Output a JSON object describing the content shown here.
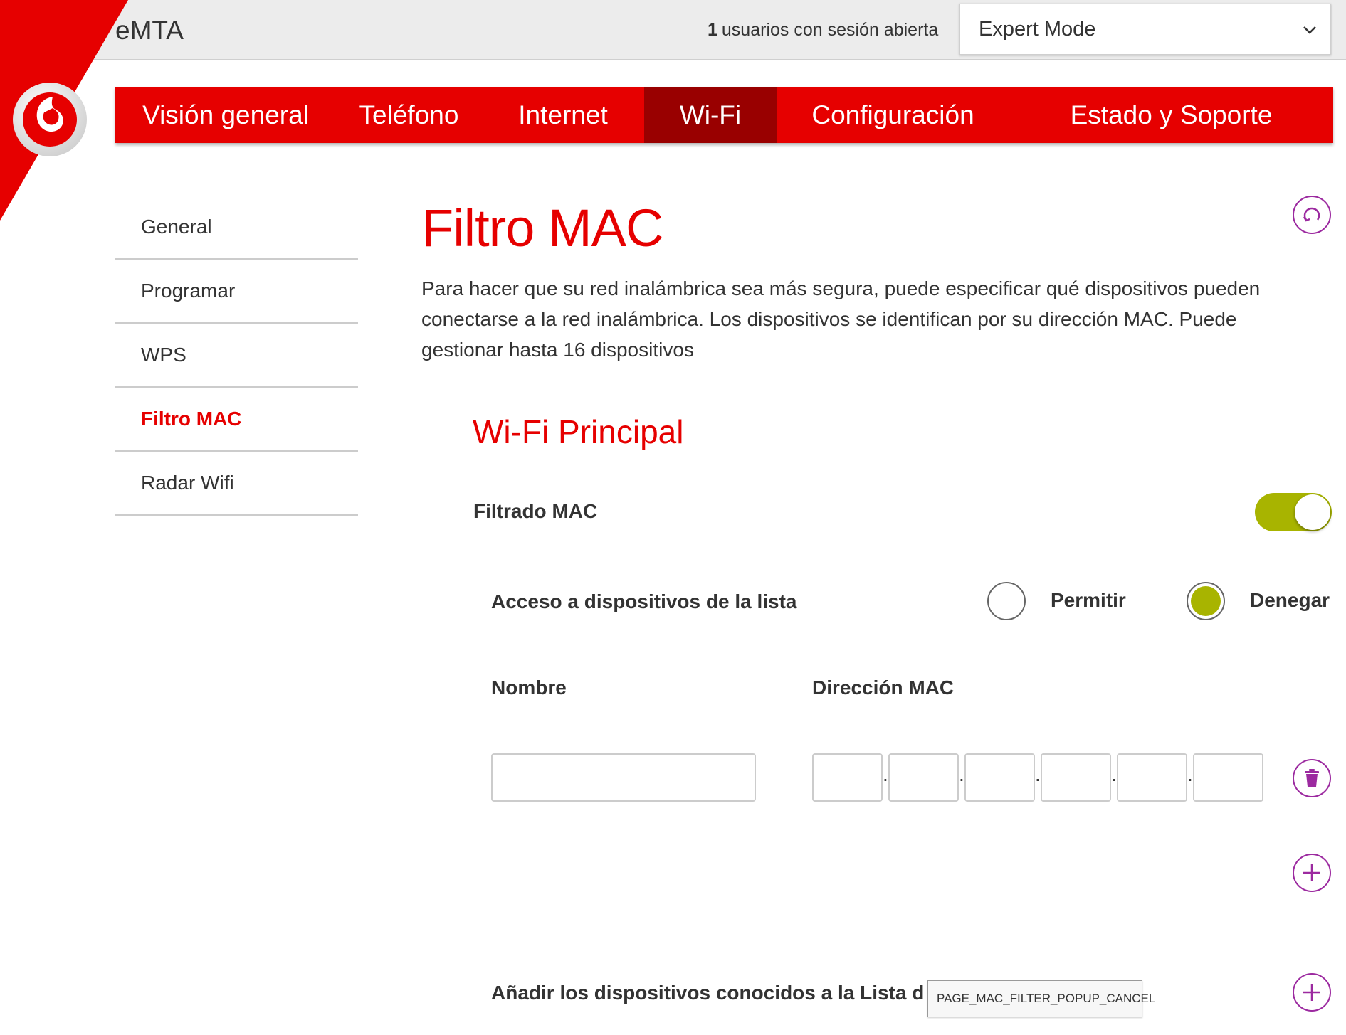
{
  "header": {
    "app_title": "eMTA",
    "users_count": "1",
    "users_text": "usuarios con sesión abierta",
    "mode_selected": "Expert Mode"
  },
  "nav": {
    "items": [
      "Visión general",
      "Teléfono",
      "Internet",
      "Wi-Fi",
      "Configuración",
      "Estado y Soporte"
    ],
    "active": "Wi-Fi"
  },
  "sidebar": {
    "items": [
      "General",
      "Programar",
      "WPS",
      "Filtro MAC",
      "Radar Wifi"
    ],
    "active": "Filtro MAC"
  },
  "main": {
    "title": "Filtro MAC",
    "description": "Para hacer que su red inalámbrica sea más segura, puede especificar qué dispositivos pueden conectarse a la red inalámbrica. Los dispositivos se identifican por su dirección MAC. Puede gestionar hasta 16 dispositivos",
    "section_title": "Wi-Fi Principal",
    "mac_filter_label": "Filtrado MAC",
    "mac_filter_enabled": true,
    "access_label": "Acceso a dispositivos de la lista",
    "access_options": [
      "Permitir",
      "Denegar"
    ],
    "access_selected": "Denegar",
    "col_name": "Nombre",
    "col_mac": "Dirección MAC",
    "name_value": "",
    "mac_values": [
      "",
      "",
      "",
      "",
      "",
      ""
    ],
    "known_devices_label": "Añadir los dispositivos conocidos a la Lista d",
    "tooltip": "PAGE_MAC_FILTER_POPUP_CANCEL"
  },
  "colors": {
    "brand_red": "#e60000",
    "nav_active": "#990000",
    "accent_green": "#a8b400",
    "icon_purple": "#9c2aa0"
  }
}
